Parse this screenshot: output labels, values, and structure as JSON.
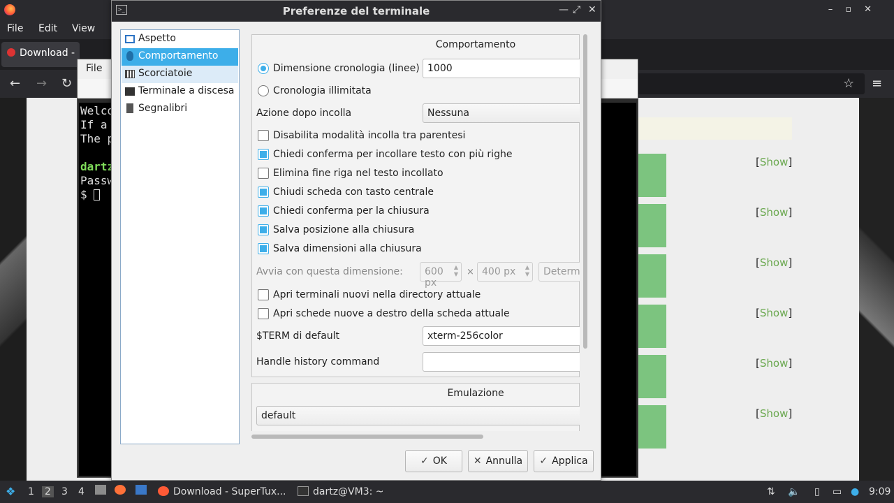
{
  "firefox": {
    "menu": [
      "File",
      "Edit",
      "View"
    ],
    "tab_title": "Download -",
    "show_link_text": "Show",
    "show_rows": 6
  },
  "terminal": {
    "menu_file": "File",
    "lines": [
      "Welco",
      "If a",
      "The p",
      "",
      "dartz",
      "Passw",
      "$ "
    ]
  },
  "dialog": {
    "title": "Preferenze del terminale",
    "title_buttons": [
      "minimize",
      "maximize",
      "close"
    ],
    "sidebar": [
      {
        "label": "Aspetto",
        "icon": "appearance-icon"
      },
      {
        "label": "Comportamento",
        "icon": "behavior-icon",
        "active": true
      },
      {
        "label": "Scorciatoie",
        "icon": "keyboard-icon"
      },
      {
        "label": "Terminale a discesa",
        "icon": "terminal-icon"
      },
      {
        "label": "Segnalibri",
        "icon": "bookmark-icon"
      }
    ],
    "behavior": {
      "group_title": "Comportamento",
      "history_size_label": "Dimensione cronologia (linee)",
      "history_size_value": "1000",
      "history_size_selected": true,
      "unlimited_history_label": "Cronologia illimitata",
      "after_paste_label": "Azione dopo incolla",
      "after_paste_value": "Nessuna",
      "options": [
        {
          "label": "Disabilita modalità incolla tra parentesi",
          "checked": false
        },
        {
          "label": "Chiedi conferma per incollare testo con più righe",
          "checked": true
        },
        {
          "label": "Elimina fine riga nel testo incollato",
          "checked": false
        },
        {
          "label": "Chiudi scheda con tasto centrale",
          "checked": true
        },
        {
          "label": "Chiedi conferma per la chiusura",
          "checked": true
        },
        {
          "label": "Salva posizione alla chiusura",
          "checked": true
        },
        {
          "label": "Salva dimensioni alla chiusura",
          "checked": true
        }
      ],
      "start_size_label": "Avvia con questa dimensione:",
      "start_width": "600 px",
      "start_height": "400 px",
      "times_symbol": "×",
      "determine_label": "Determ",
      "options2": [
        {
          "label": "Apri terminali nuovi nella directory attuale",
          "checked": false
        },
        {
          "label": "Apri schede nuove a destro della scheda attuale",
          "checked": false
        }
      ],
      "term_label": "$TERM di default",
      "term_value": "xterm-256color",
      "history_cmd_label": "Handle history command",
      "history_cmd_value": ""
    },
    "emulation": {
      "group_title": "Emulazione",
      "value": "default"
    },
    "buttons": {
      "ok": "OK",
      "cancel": "Annulla",
      "apply": "Applica"
    }
  },
  "taskbar": {
    "workspaces": [
      "1",
      "2",
      "3",
      "4"
    ],
    "active_workspace": "2",
    "tasks": [
      {
        "label": "Download - SuperTux...",
        "icon": "firefox-icon"
      },
      {
        "label": "dartz@VM3: ~",
        "icon": "terminal-icon"
      }
    ],
    "clock": "9:09"
  }
}
